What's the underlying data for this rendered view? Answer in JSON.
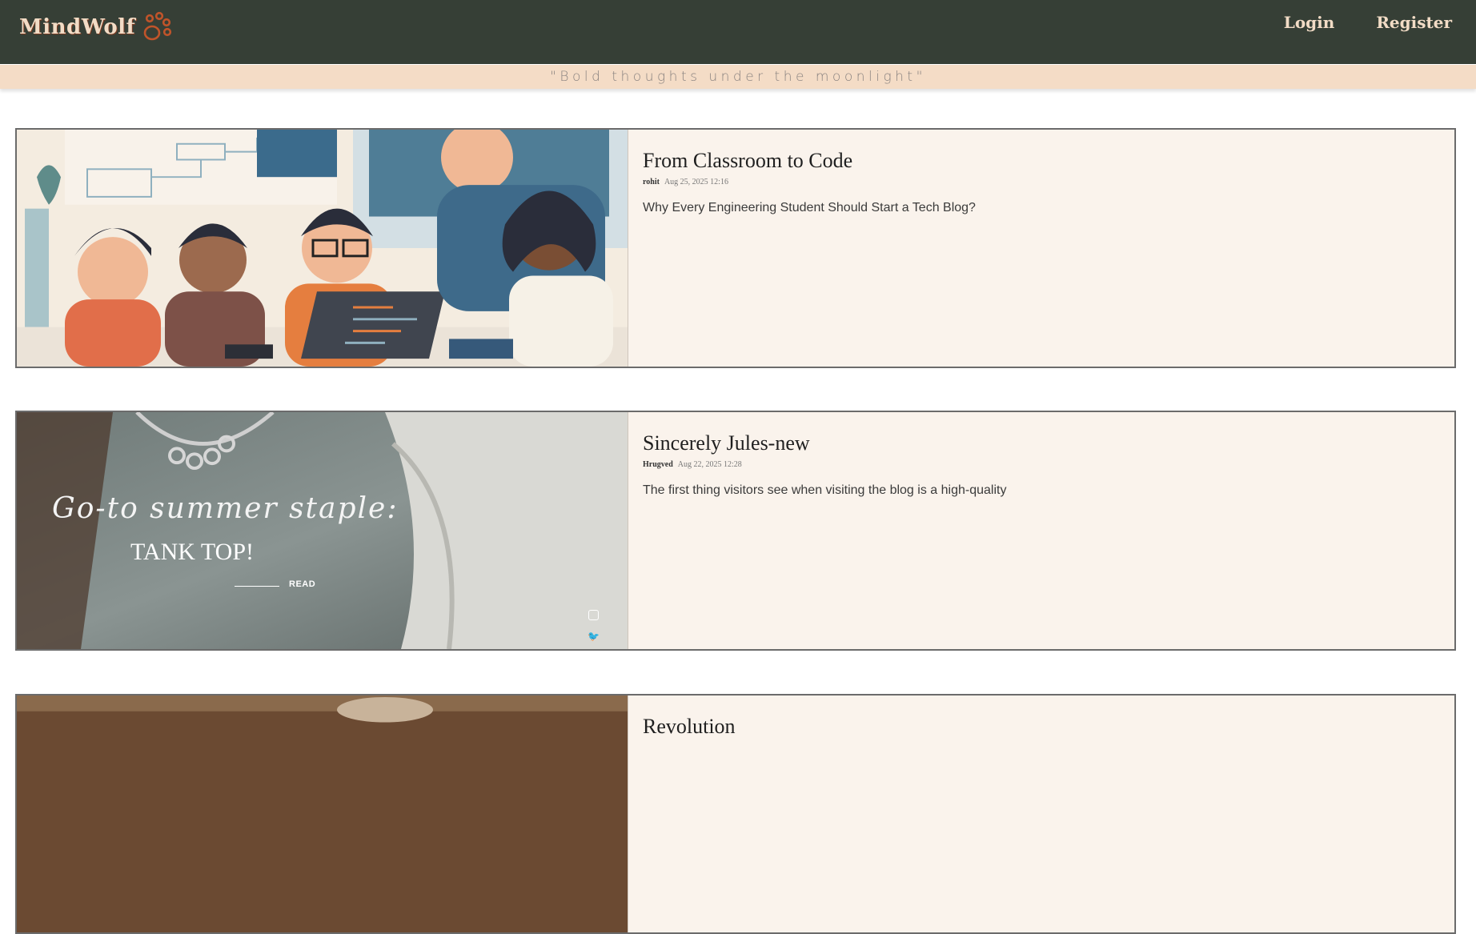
{
  "header": {
    "brand": "MindWolf",
    "nav": {
      "login": "Login",
      "register": "Register"
    },
    "tagline": "\"Bold thoughts under the moonlight\""
  },
  "colors": {
    "header_bg": "#363f36",
    "tagline_bg": "#f4dcc6",
    "card_bg": "#faf3ec",
    "accent": "#c0542a"
  },
  "posts": [
    {
      "title": "From Classroom to Code",
      "author": "rohit",
      "date": "Aug 25, 2025 12:16",
      "excerpt": "Why Every Engineering Student Should Start a Tech Blog?"
    },
    {
      "title": "Sincerely Jules-new",
      "author": "Hrugved",
      "date": "Aug 22, 2025 12:28",
      "excerpt": "The first thing visitors see when visiting the blog is a high-quality",
      "image_text": {
        "script": "Go-to summer staple:",
        "headline": "TANK TOP!",
        "read": "READ"
      }
    },
    {
      "title": "Revolution",
      "author": "",
      "date": "",
      "excerpt": ""
    }
  ]
}
